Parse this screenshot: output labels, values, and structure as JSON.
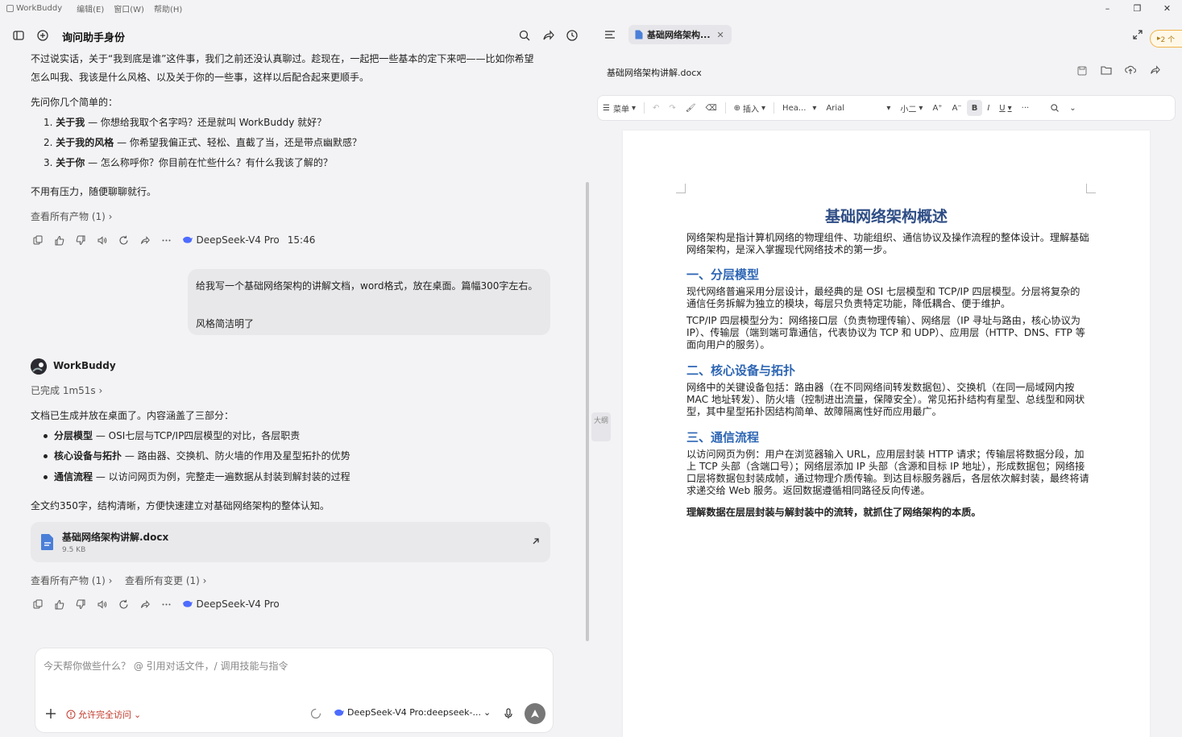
{
  "app": {
    "name": "WorkBuddy",
    "menu": [
      "编辑(E)",
      "窗口(W)",
      "帮助(H)"
    ]
  },
  "window_controls": {
    "minimize": "–",
    "restore": "❐",
    "close": "✕"
  },
  "left": {
    "title": "询问助手身份",
    "intro_line1": "不过说实话，关于“我到底是谁”这件事，我们之前还没认真聊过。趁现在，一起把一些基本的定下来吧——比如你希望",
    "intro_line2": "怎么叫我、我该是什么风格、以及关于你的一些事，这样以后配合起来更顺手。",
    "ask": "先问你几个简单的：",
    "questions": [
      {
        "num": "1.",
        "bold": "关于我",
        "text": " — 你想给我取个名字吗？还是就叫 WorkBuddy 就好？"
      },
      {
        "num": "2.",
        "bold": "关于我的风格",
        "text": " — 你希望我偏正式、轻松、直截了当，还是带点幽默感？"
      },
      {
        "num": "3.",
        "bold": "关于你",
        "text": " — 怎么称呼你？你目前在忙些什么？有什么我该了解的？"
      }
    ],
    "no_pressure": "不用有压力，随便聊聊就行。",
    "view_artifacts_1": "查看所有产物 (1)",
    "model_name": "DeepSeek-V4 Pro",
    "time": "15:46",
    "user_msg_line1": "给我写一个基础网络架构的讲解文档，word格式，放在桌面。篇幅300字左右。",
    "user_msg_line2": "风格简洁明了",
    "bot_name": "WorkBuddy",
    "done": "已完成 1m51s",
    "reply_intro": "文档已生成并放在桌面了。内容涵盖了三部分：",
    "reply_items": [
      {
        "bold": "分层模型",
        "text": " — OSI七层与TCP/IP四层模型的对比，各层职责"
      },
      {
        "bold": "核心设备与拓扑",
        "text": " — 路由器、交换机、防火墙的作用及星型拓扑的优势"
      },
      {
        "bold": "通信流程",
        "text": " — 以访问网页为例，完整走一遍数据从封装到解封装的过程"
      }
    ],
    "reply_summary": "全文约350字，结构清晰，方便快速建立对基础网络架构的整体认知。",
    "file": {
      "name": "基础网络架构讲解.docx",
      "size": "9.5 KB"
    },
    "view_artifacts_2": "查看所有产物 (1)",
    "view_changes": "查看所有变更 (1)",
    "input": {
      "placeholder": "今天帮你做些什么？ @ 引用对话文件，/ 调用技能与指令",
      "permission": "允许完全访问",
      "model_select": "DeepSeek-V4 Pro:deepseek-..."
    }
  },
  "right": {
    "tab_label": "基础网络架构...",
    "badge": "2 个",
    "doc_filename": "基础网络架构讲解.docx",
    "side_tab": "大纲",
    "toolbar": {
      "menu": "菜单",
      "insert": "插入",
      "style": "Hea...",
      "font": "Arial",
      "size": "小二"
    },
    "doc": {
      "title": "基础网络架构概述",
      "intro": "网络架构是指计算机网络的物理组件、功能组织、通信协议及操作流程的整体设计。理解基础网络架构，是深入掌握现代网络技术的第一步。",
      "h1": "一、分层模型",
      "p1": "现代网络普遍采用分层设计，最经典的是 OSI 七层模型和 TCP/IP 四层模型。分层将复杂的通信任务拆解为独立的模块，每层只负责特定功能，降低耦合、便于维护。",
      "p2": "TCP/IP 四层模型分为：网络接口层（负责物理传输）、网络层（IP 寻址与路由，核心协议为 IP）、传输层（端到端可靠通信，代表协议为 TCP 和 UDP）、应用层（HTTP、DNS、FTP 等面向用户的服务）。",
      "h2": "二、核心设备与拓扑",
      "p3": "网络中的关键设备包括：路由器（在不同网络间转发数据包）、交换机（在同一局域网内按 MAC 地址转发）、防火墙（控制进出流量，保障安全）。常见拓扑结构有星型、总线型和网状型，其中星型拓扑因结构简单、故障隔离性好而应用最广。",
      "h3": "三、通信流程",
      "p4": "以访问网页为例：用户在浏览器输入 URL，应用层封装 HTTP 请求；传输层将数据分段，加上 TCP 头部（含端口号）；网络层添加 IP 头部（含源和目标 IP 地址），形成数据包；网络接口层将数据包封装成帧，通过物理介质传输。到达目标服务器后，各层依次解封装，最终将请求递交给 Web 服务。返回数据遵循相同路径反向传递。",
      "conclusion": "理解数据在层层封装与解封装中的流转，就抓住了网络架构的本质。"
    }
  },
  "colors": {
    "accent": "#2e66b4",
    "title": "#2e4d85",
    "warning": "#c0392b"
  }
}
